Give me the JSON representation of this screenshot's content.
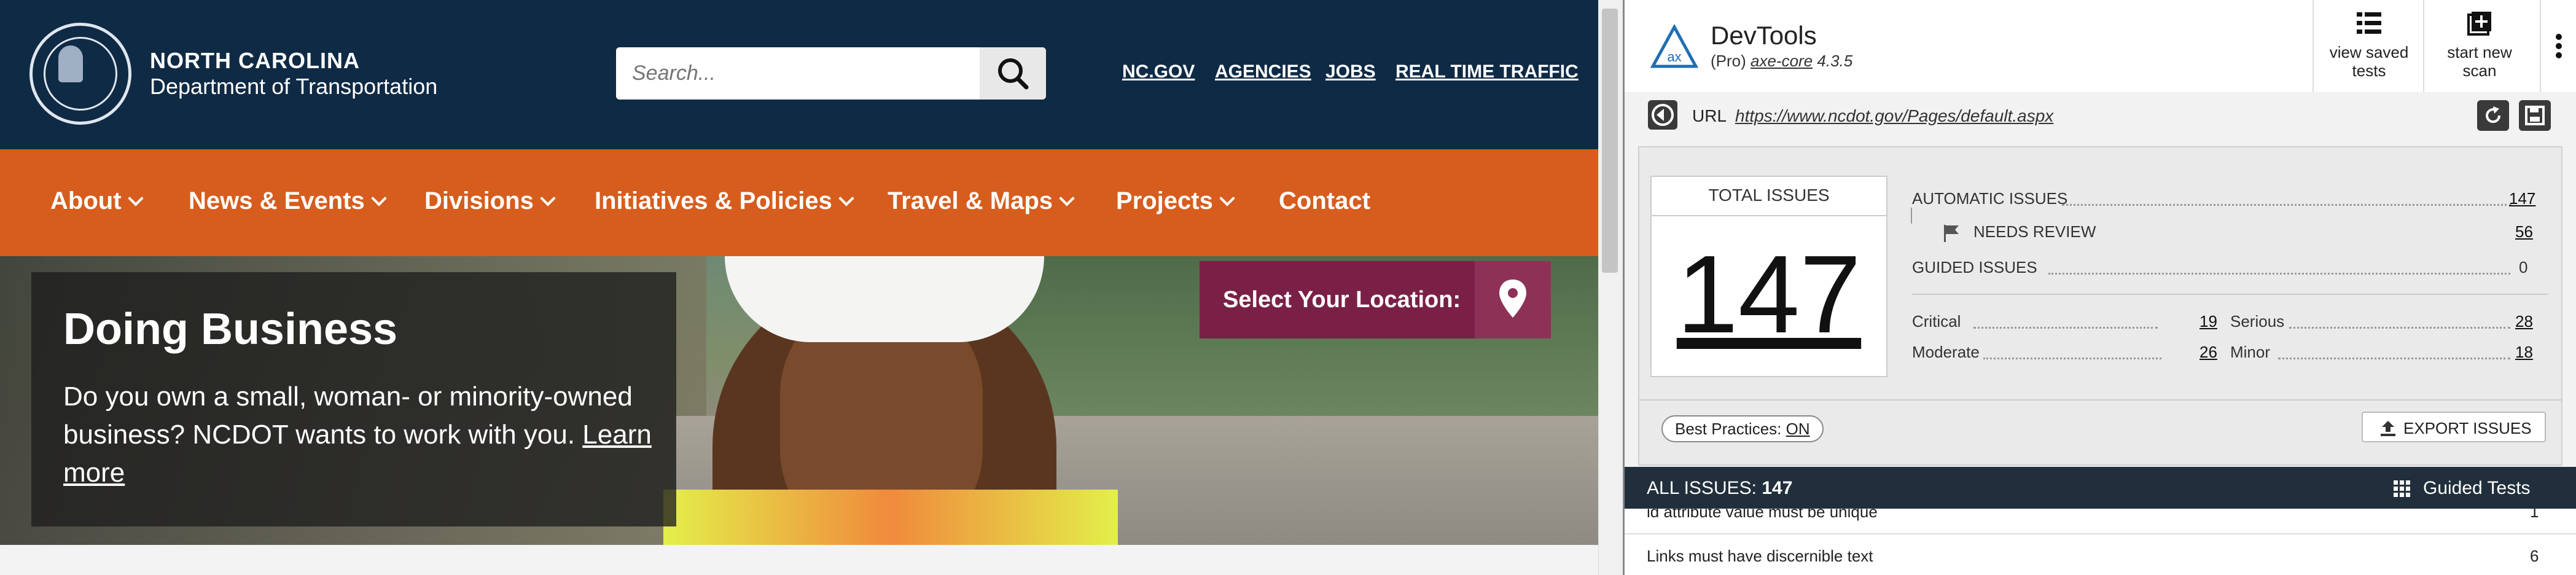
{
  "site": {
    "brand_line1": "NORTH CAROLINA",
    "brand_line2": "Department of Transportation",
    "search_placeholder": "Search...",
    "top_links": [
      "NC.GOV",
      "AGENCIES",
      "JOBS",
      "REAL TIME TRAFFIC"
    ],
    "nav": [
      "About",
      "News & Events",
      "Divisions",
      "Initiatives & Policies",
      "Travel & Maps",
      "Projects",
      "Contact"
    ],
    "hero": {
      "title": "Doing Business",
      "text": "Do you own a small, woman- or minority-owned business? NCDOT wants to work with you.",
      "link": "Learn more"
    },
    "location_button": "Select Your Location:"
  },
  "devtools": {
    "title": "DevTools",
    "subtitle_prefix": "(Pro)",
    "product": "axe-core",
    "version": "4.3.5",
    "view_saved_line1": "view saved",
    "view_saved_line2": "tests",
    "start_new_line1": "start new",
    "start_new_line2": "scan",
    "url_label": "URL",
    "url": "https://www.ncdot.gov/Pages/default.aspx",
    "total_issues_label": "TOTAL ISSUES",
    "total_issues": "147",
    "automatic_label": "AUTOMATIC ISSUES",
    "automatic": "147",
    "needs_review_label": "NEEDS REVIEW",
    "needs_review": "56",
    "guided_label": "GUIDED ISSUES",
    "guided": "0",
    "critical_label": "Critical",
    "critical": "19",
    "serious_label": "Serious",
    "serious": "28",
    "moderate_label": "Moderate",
    "moderate": "26",
    "minor_label": "Minor",
    "minor": "18",
    "best_practices_prefix": "Best Practices:",
    "best_practices_state": "ON",
    "export": "EXPORT ISSUES",
    "all_issues_label": "ALL ISSUES:",
    "all_issues": "147",
    "guided_tests": "Guided Tests",
    "issues": [
      {
        "label": "id attribute value must be unique",
        "count": "1"
      },
      {
        "label": "Links must have discernible text",
        "count": "6"
      }
    ]
  },
  "colors": {
    "header_navy": "#0f2a45",
    "nav_orange": "#d65d1d",
    "location_maroon": "#7a2046",
    "devtools_dark_bar": "#212f3c"
  }
}
